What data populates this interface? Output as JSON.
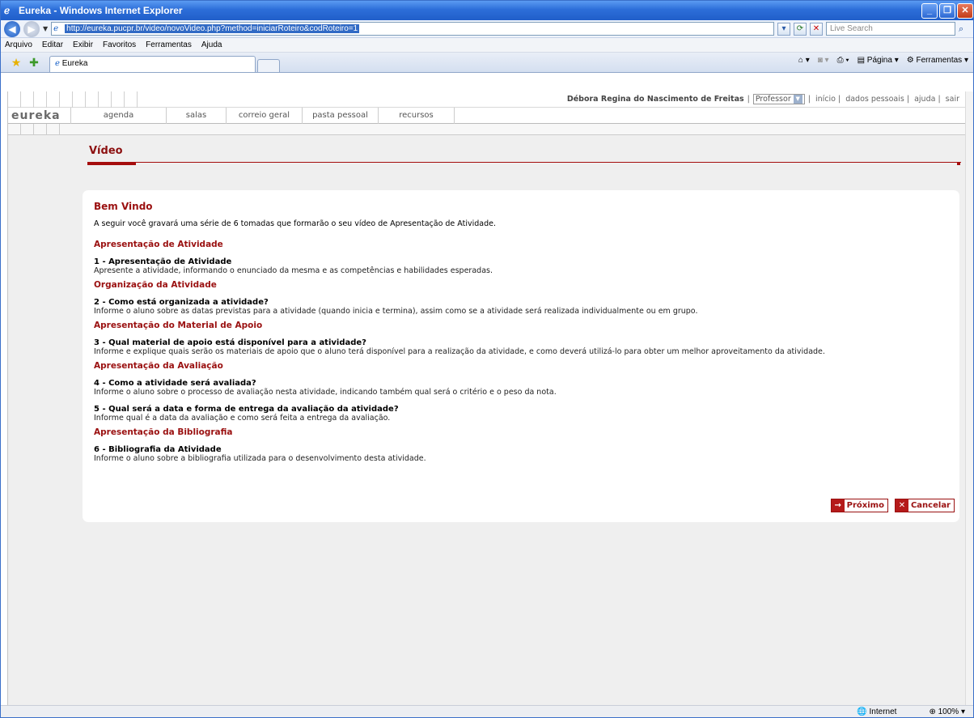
{
  "window": {
    "title": "Eureka - Windows Internet Explorer"
  },
  "address": {
    "url": "http://eureka.pucpr.br/video/novoVideo.php?method=iniciarRoteiro&codRoteiro=1",
    "search_placeholder": "Live Search"
  },
  "menu": [
    "Arquivo",
    "Editar",
    "Exibir",
    "Favoritos",
    "Ferramentas",
    "Ajuda"
  ],
  "tab": {
    "label": "Eureka"
  },
  "command": {
    "page": "Página",
    "tools": "Ferramentas"
  },
  "eureka": {
    "user": "Débora Regina do Nascimento de Freitas",
    "role": "Professor",
    "links": [
      "início",
      "dados pessoais",
      "ajuda",
      "sair"
    ],
    "logo": "eureka",
    "nav": [
      "agenda",
      "salas",
      "correio geral",
      "pasta pessoal",
      "recursos"
    ],
    "page_title": "Vídeo"
  },
  "card": {
    "title": "Bem Vindo",
    "intro": "A seguir você gravará uma série de 6 tomadas que formarão o seu vídeo de Apresentação de Atividade.",
    "sections": [
      {
        "title": "Apresentação de Atividade",
        "items": [
          {
            "q": "1 - Apresentação de Atividade",
            "d": "Apresente a atividade, informando o enunciado da mesma e as competências e habilidades esperadas."
          }
        ]
      },
      {
        "title": "Organização da Atividade",
        "items": [
          {
            "q": "2 - Como está organizada a atividade?",
            "d": "Informe o aluno sobre as datas previstas para a atividade (quando inicia e termina), assim como se a atividade será realizada individualmente ou em grupo."
          }
        ]
      },
      {
        "title": "Apresentação do Material de Apoio",
        "items": [
          {
            "q": "3 - Qual material de apoio está disponível para a atividade?",
            "d": "Informe e explique quais serão os materiais de apoio que o aluno terá disponível para a realização da atividade, e como deverá utilizá-lo para obter um melhor aproveitamento da atividade."
          }
        ]
      },
      {
        "title": "Apresentação da Avaliação",
        "items": [
          {
            "q": "4 - Como a atividade será avaliada?",
            "d": "Informe o aluno sobre o processo de avaliação nesta atividade, indicando também qual será o critério e o peso da nota."
          },
          {
            "q": "5 - Qual será a data e forma de entrega da avaliação da atividade?",
            "d": "Informe qual é a data da avaliação e como será feita a entrega da avaliação."
          }
        ]
      },
      {
        "title": "Apresentação da Bibliografia",
        "items": [
          {
            "q": "6 - Bibliografia da Atividade",
            "d": "Informe o aluno sobre a bibliografia utilizada para o desenvolvimento desta atividade."
          }
        ]
      }
    ],
    "next_label": "Próximo",
    "cancel_label": "Cancelar"
  },
  "status": {
    "zone": "Internet",
    "zoom": "100%"
  }
}
